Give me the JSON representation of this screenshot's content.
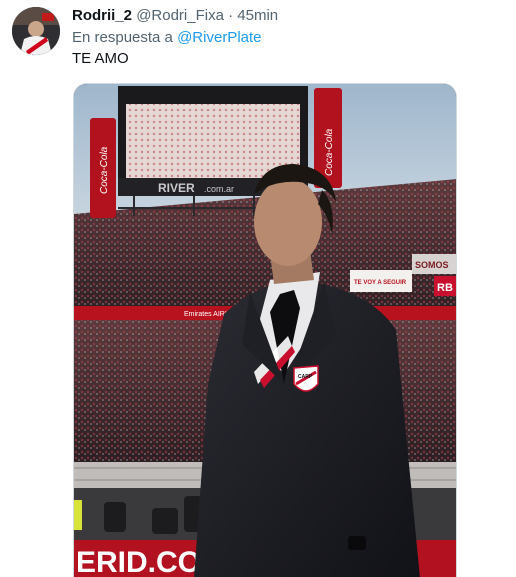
{
  "tweet": {
    "display_name": "Rodrii_2",
    "handle": "@Rodri_Fixa",
    "separator": "·",
    "time": "45min",
    "reply_prefix": "En respuesta a",
    "reply_to": "@RiverPlate",
    "text": "TE AMO"
  },
  "photo": {
    "scoreboard_brand": "RIVER",
    "scoreboard_domain": ".com.ar",
    "sponsor_left": "Coca-Cola",
    "sponsor_right": "Coca-Cola",
    "banner_1": "TE VOY A SEGUIR",
    "banner_2": "SOMOS",
    "banner_3": "RB",
    "ad_board": "Emirates AIRLINES",
    "led_board": "ERID.CO",
    "badge_text": "CARP"
  }
}
